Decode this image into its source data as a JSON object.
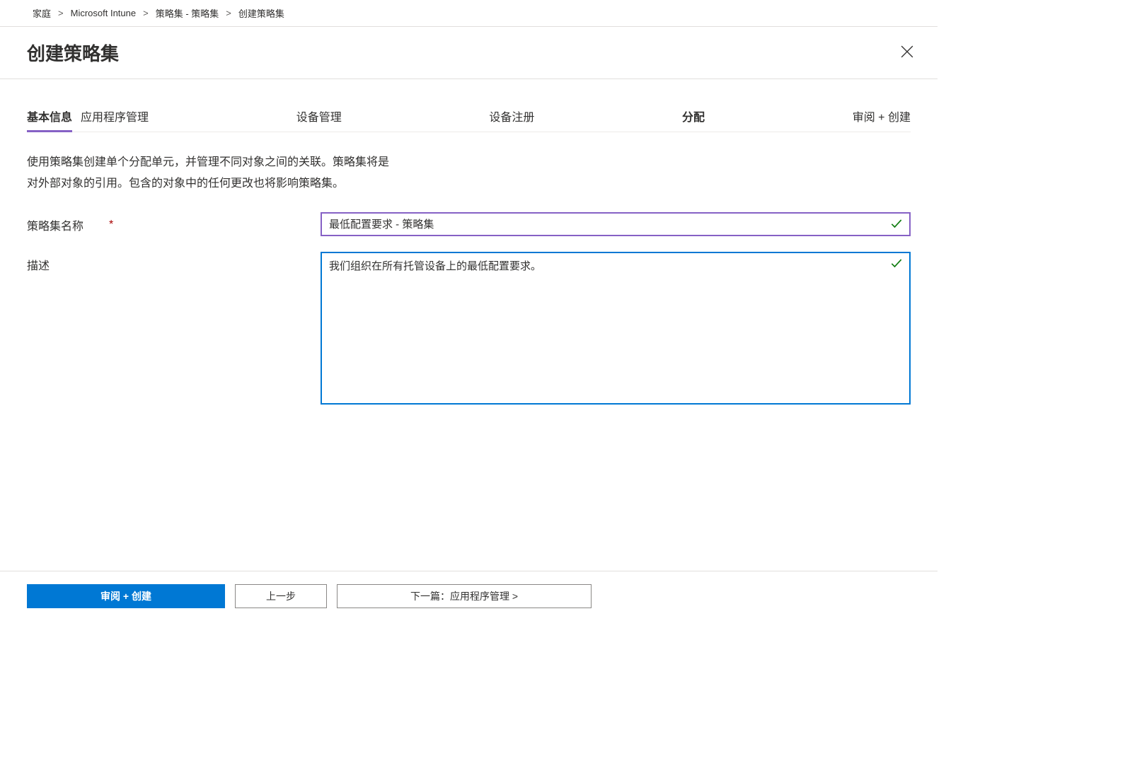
{
  "breadcrumb": {
    "items": [
      {
        "label": "家庭"
      },
      {
        "label": "Microsoft Intune"
      },
      {
        "label": "策略集 - 策略集"
      },
      {
        "label": "创建策略集"
      }
    ],
    "sep": "&gt;"
  },
  "header": {
    "title": "创建策略集"
  },
  "tabs": [
    {
      "label": "基本信息",
      "active": true
    },
    {
      "label": "应用程序管理"
    },
    {
      "label": "设备管理"
    },
    {
      "label": "设备注册"
    },
    {
      "label": "分配"
    },
    {
      "label": "审阅 + 创建"
    }
  ],
  "description": {
    "line1": "使用策略集创建单个分配单元，并管理不同对象之间的关联。策略集将是",
    "line2": "对外部对象的引用。包含的对象中的任何更改也将影响策略集。"
  },
  "form": {
    "name_label": "策略集名称",
    "required_mark": "*",
    "name_value": "最低配置要求 - 策略集",
    "desc_label": "描述",
    "desc_value": "我们组织在所有托管设备上的最低配置要求。"
  },
  "footer": {
    "review_create": "审阅 + 创建",
    "previous": "上一步",
    "next": "下一篇：应用程序管理 &gt;"
  }
}
